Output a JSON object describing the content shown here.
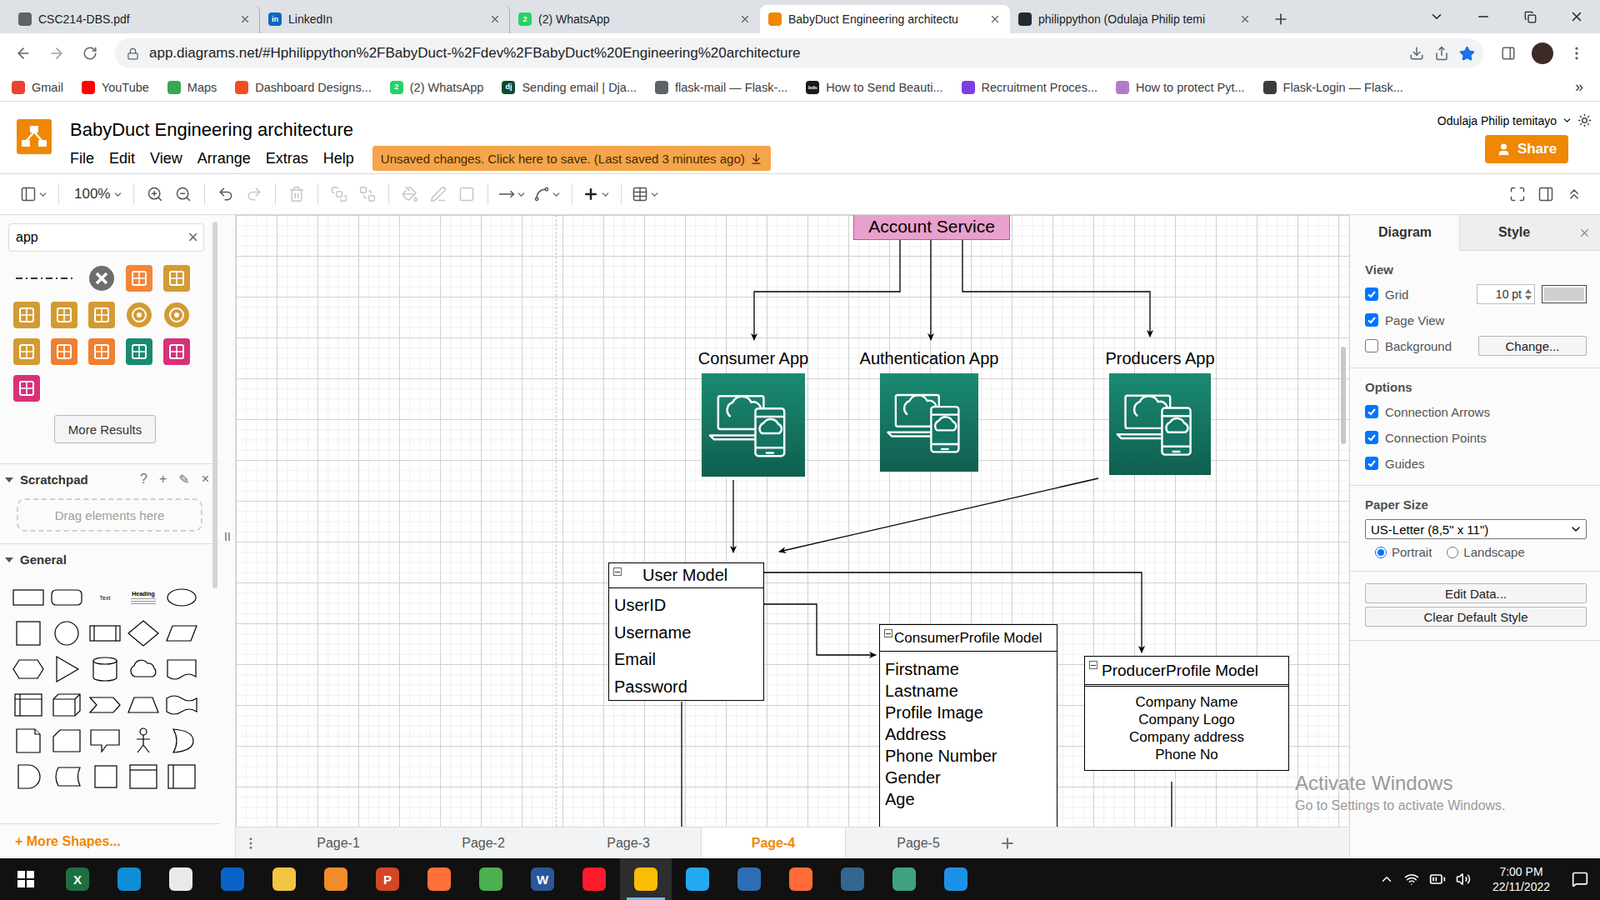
{
  "browser": {
    "tabs": [
      {
        "label": "CSC214-DBS.pdf",
        "selected": false,
        "color": "#5f6368"
      },
      {
        "label": "LinkedIn",
        "selected": false,
        "color": "#0a66c2",
        "glyph": "in"
      },
      {
        "label": "(2) WhatsApp",
        "selected": false,
        "color": "#25d366",
        "glyph": "2"
      },
      {
        "label": "BabyDuct Engineering architectu",
        "selected": true,
        "color": "#f08705"
      },
      {
        "label": "philippython (Odulaja Philip temi",
        "selected": false,
        "color": "#24292f"
      }
    ],
    "url": "app.diagrams.net/#Hphilippython%2FBabyDuct-%2Fdev%2FBabyDuct%20Engineering%20architecture",
    "starred": true,
    "bookmarks": [
      {
        "label": "Gmail",
        "color": "#ea4335"
      },
      {
        "label": "YouTube",
        "color": "#ff0000"
      },
      {
        "label": "Maps",
        "color": "#34a853"
      },
      {
        "label": "Dashboard Designs...",
        "color": "#f24e1e"
      },
      {
        "label": "(2) WhatsApp",
        "color": "#25d366",
        "glyph": "2"
      },
      {
        "label": "Sending email | Dja...",
        "color": "#0c4b33",
        "glyph": "dj"
      },
      {
        "label": "flask-mail — Flask-...",
        "color": "#5f6368"
      },
      {
        "label": "How to Send Beauti...",
        "color": "#1a1a1a",
        "glyph": "bds"
      },
      {
        "label": "Recruitment Proces...",
        "color": "#7b3fe4"
      },
      {
        "label": "How to protect Pyt...",
        "color": "#b07cc6"
      },
      {
        "label": "Flask-Login — Flask...",
        "color": "#3c3c3c"
      }
    ],
    "bookmarks_more": "»"
  },
  "app": {
    "title": "BabyDuct Engineering architecture",
    "menus": [
      "File",
      "Edit",
      "View",
      "Arrange",
      "Extras",
      "Help"
    ],
    "banner": "Unsaved changes. Click here to save. (Last saved 3 minutes ago)",
    "user": "Odulaja Philip temitayo",
    "share": "Share"
  },
  "toolbar": {
    "zoom": "100%",
    "groups": [
      [
        {
          "kind": "sidebar",
          "disabled": false,
          "menu": true
        }
      ],
      [
        {
          "kind": "zoomin",
          "disabled": false,
          "menu": false
        },
        {
          "kind": "zoomout",
          "disabled": false,
          "menu": false
        }
      ],
      [
        {
          "kind": "undo",
          "disabled": false,
          "menu": false
        },
        {
          "kind": "redo",
          "disabled": true,
          "menu": false
        }
      ],
      [
        {
          "kind": "delete",
          "disabled": true,
          "menu": false
        }
      ],
      [
        {
          "kind": "tofront",
          "disabled": true,
          "menu": false
        },
        {
          "kind": "toback",
          "disabled": true,
          "menu": false
        }
      ],
      [
        {
          "kind": "fill",
          "disabled": true,
          "menu": false
        },
        {
          "kind": "line",
          "disabled": true,
          "menu": false
        },
        {
          "kind": "shadow",
          "disabled": true,
          "menu": false
        }
      ],
      [
        {
          "kind": "connection",
          "disabled": false,
          "menu": true
        },
        {
          "kind": "waypoints",
          "disabled": false,
          "menu": true
        }
      ],
      [
        {
          "kind": "insert",
          "disabled": false,
          "menu": true
        }
      ],
      [
        {
          "kind": "table",
          "disabled": false,
          "menu": true
        }
      ]
    ],
    "right": [
      {
        "kind": "fullscreen",
        "disabled": false,
        "menu": false
      },
      {
        "kind": "format",
        "disabled": false,
        "menu": false
      },
      {
        "kind": "collapse",
        "disabled": false,
        "menu": false
      }
    ]
  },
  "sidebar": {
    "search": "app",
    "clear": "×",
    "results": [
      {
        "kind": "line",
        "color": "#333333"
      },
      {
        "kind": "circle",
        "color": "#6d6d6d"
      },
      {
        "kind": "tile",
        "color": "#f58536"
      },
      {
        "kind": "tile",
        "color": "#d39b34"
      },
      {
        "kind": "tile",
        "color": "#d39b34"
      },
      {
        "kind": "tile",
        "color": "#d39b34"
      },
      {
        "kind": "tile",
        "color": "#d39b34"
      },
      {
        "kind": "round",
        "color": "#d39b34"
      },
      {
        "kind": "round",
        "color": "#d39b34"
      },
      {
        "kind": "tile",
        "color": "#d39b34"
      },
      {
        "kind": "tile",
        "color": "#f08030"
      },
      {
        "kind": "tile",
        "color": "#f08030"
      },
      {
        "kind": "tile",
        "color": "#1a8a73"
      },
      {
        "kind": "tile",
        "color": "#d6327a"
      },
      {
        "kind": "tile",
        "color": "#d6327a"
      }
    ],
    "more_results": "More Results",
    "scratchpad": {
      "title": "Scratchpad",
      "expanded": true,
      "actions": [
        "?",
        "+",
        "✎",
        "×"
      ],
      "drop_hint": "Drag elements here"
    },
    "general": {
      "title": "General",
      "expanded": true,
      "shapes": [
        {
          "kind": "rect"
        },
        {
          "kind": "rounded"
        },
        {
          "kind": "text",
          "label": "Text"
        },
        {
          "kind": "heading",
          "label": "Heading"
        },
        {
          "kind": "ellipse"
        },
        {
          "kind": "square"
        },
        {
          "kind": "circle"
        },
        {
          "kind": "process"
        },
        {
          "kind": "diamond"
        },
        {
          "kind": "parallelogram"
        },
        {
          "kind": "hexagon"
        },
        {
          "kind": "triangle"
        },
        {
          "kind": "cylinder"
        },
        {
          "kind": "cloud"
        },
        {
          "kind": "document"
        },
        {
          "kind": "internal"
        },
        {
          "kind": "cube"
        },
        {
          "kind": "step"
        },
        {
          "kind": "trapezoid"
        },
        {
          "kind": "tape"
        },
        {
          "kind": "note"
        },
        {
          "kind": "card"
        },
        {
          "kind": "callout"
        },
        {
          "kind": "actor"
        },
        {
          "kind": "or"
        },
        {
          "kind": "and"
        },
        {
          "kind": "storage"
        },
        {
          "kind": "box"
        },
        {
          "kind": "container"
        },
        {
          "kind": "swimlane"
        }
      ]
    },
    "more_shapes": "+ More Shapes..."
  },
  "diagram": {
    "service": {
      "label": "Account Service",
      "color": "#e8a1cc"
    },
    "apps": [
      {
        "label": "Consumer App"
      },
      {
        "label": "Authentication App"
      },
      {
        "label": "Producers App"
      }
    ],
    "models": [
      {
        "title": "User Model",
        "kind": "list",
        "fields": [
          "UserID",
          "Username",
          "Email",
          "Password"
        ]
      },
      {
        "title": "ConsumerProfile Model",
        "kind": "list",
        "fields": [
          "Firstname",
          "Lastname",
          "Profile Image",
          "Address",
          "Phone Number",
          "Gender",
          "Age"
        ]
      },
      {
        "title": "ProducerProfile Model",
        "kind": "centered",
        "fields": [
          "Company Name",
          "Company Logo",
          "Company address",
          "Phone No"
        ]
      }
    ]
  },
  "format_panel": {
    "tabs": [
      {
        "label": "Diagram",
        "selected": true
      },
      {
        "label": "Style",
        "selected": false
      }
    ],
    "view": {
      "title": "View",
      "grid": {
        "label": "Grid",
        "checked": true,
        "size": "10 pt",
        "color": "#d0d0d0"
      },
      "page_view": {
        "label": "Page View",
        "checked": true
      },
      "background": {
        "label": "Background",
        "checked": false,
        "button": "Change..."
      }
    },
    "options": {
      "title": "Options",
      "items": [
        {
          "label": "Connection Arrows",
          "checked": true
        },
        {
          "label": "Connection Points",
          "checked": true
        },
        {
          "label": "Guides",
          "checked": true
        }
      ]
    },
    "paper": {
      "title": "Paper Size",
      "value": "US-Letter (8,5\" x 11\")",
      "orientations": [
        {
          "label": "Portrait",
          "selected": true
        },
        {
          "label": "Landscape",
          "selected": false
        }
      ]
    },
    "actions": [
      "Edit Data...",
      "Clear Default Style"
    ]
  },
  "pages": [
    {
      "label": "Page-1",
      "selected": false
    },
    {
      "label": "Page-2",
      "selected": false
    },
    {
      "label": "Page-3",
      "selected": false
    },
    {
      "label": "Page-4",
      "selected": true
    },
    {
      "label": "Page-5",
      "selected": false
    }
  ],
  "watermark": {
    "title": "Activate Windows",
    "subtitle": "Go to Settings to activate Windows."
  },
  "taskbar": {
    "apps": [
      {
        "color": "#1d6f42",
        "glyph": "X",
        "active": false
      },
      {
        "color": "#0f8fd8",
        "active": false
      },
      {
        "color": "#e9e9e9",
        "active": false
      },
      {
        "color": "#0a64c8",
        "active": false
      },
      {
        "color": "#f4c542",
        "active": false
      },
      {
        "color": "#f28b2b",
        "active": false
      },
      {
        "color": "#d24726",
        "glyph": "P",
        "active": false
      },
      {
        "color": "#ff7139",
        "active": false
      },
      {
        "color": "#4caf50",
        "active": false
      },
      {
        "color": "#2b579a",
        "glyph": "W",
        "active": false
      },
      {
        "color": "#ff1b2d",
        "active": false
      },
      {
        "color": "#fbbc04",
        "active": true
      },
      {
        "color": "#23a9f2",
        "active": false
      },
      {
        "color": "#2f6db5",
        "active": false
      },
      {
        "color": "#ff6c37",
        "active": false
      },
      {
        "color": "#336791",
        "active": false
      },
      {
        "color": "#3fa37f",
        "active": false
      },
      {
        "color": "#1d91e6",
        "active": false
      }
    ],
    "time": "7:00 PM",
    "date": "22/11/2022"
  }
}
